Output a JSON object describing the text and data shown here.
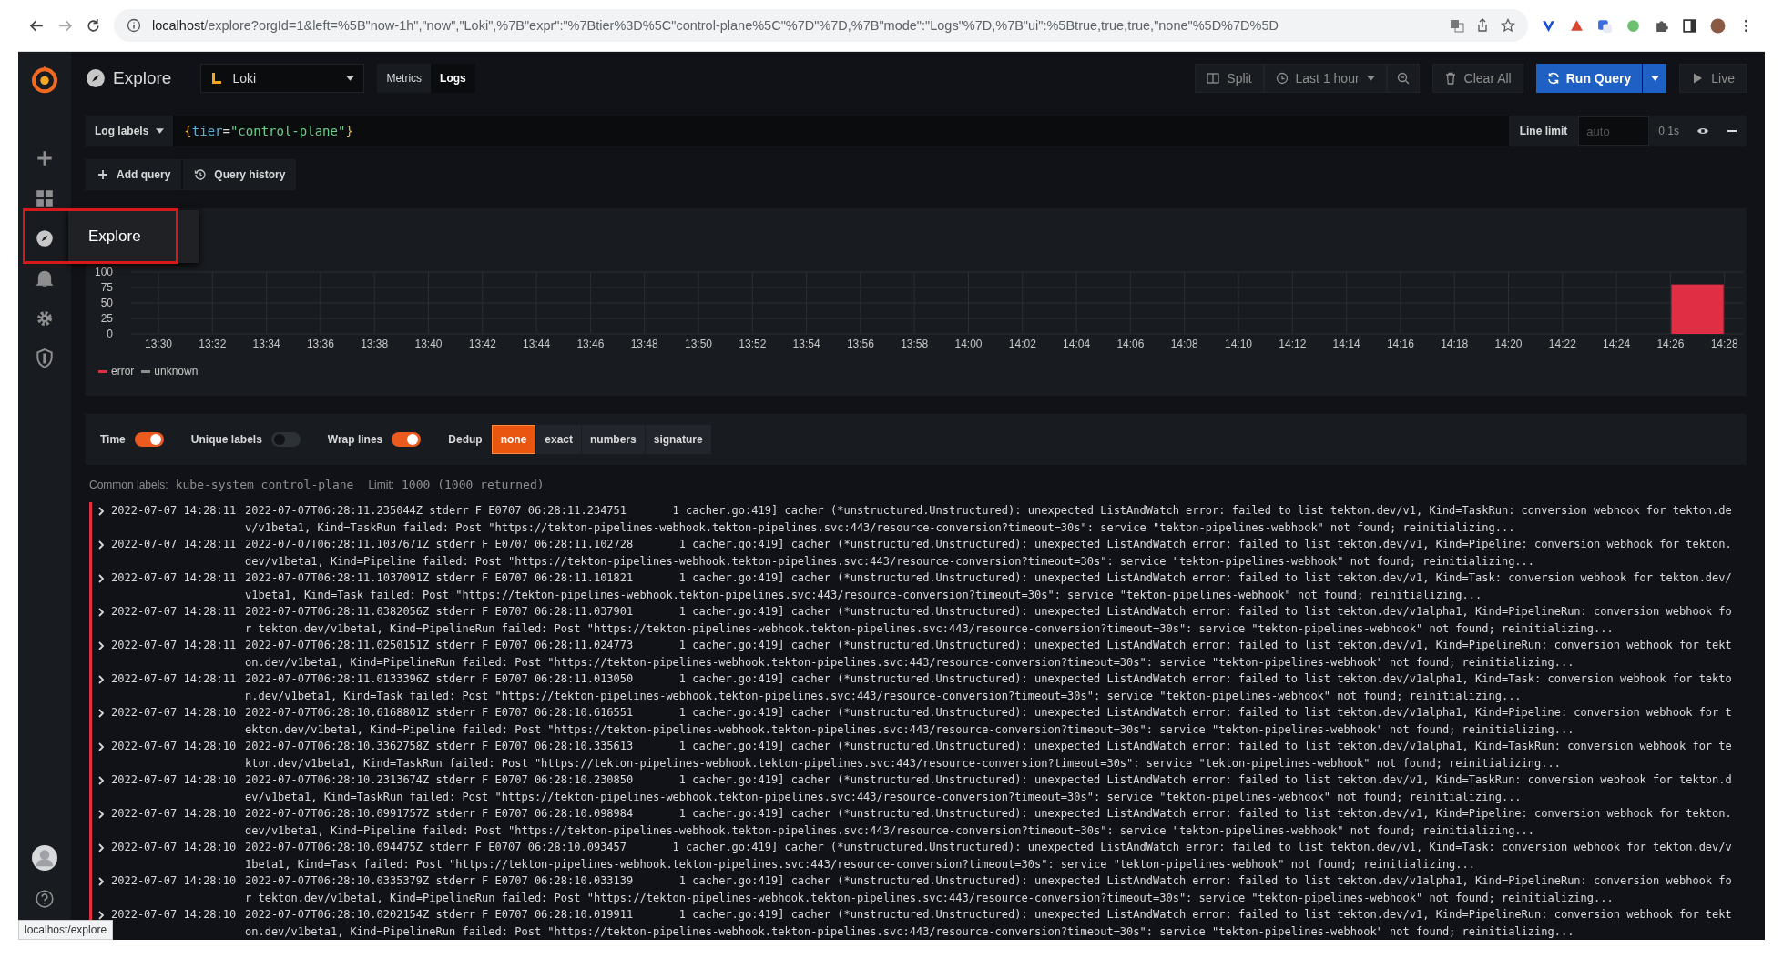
{
  "browser": {
    "host": "localhost",
    "path": "/explore?orgId=1&left=%5B\"now-1h\",\"now\",\"Loki\",%7B\"expr\":\"%7Btier%3D%5C\"control-plane%5C\"%7D\"%7D,%7B\"mode\":\"Logs\"%7D,%7B\"ui\":%5Btrue,true,true,\"none\"%5D%7D%5D"
  },
  "sidebar": {
    "flyout": "Explore"
  },
  "toolbar": {
    "title": "Explore",
    "datasource": "Loki",
    "modes": [
      {
        "label": "Metrics",
        "selected": false
      },
      {
        "label": "Logs",
        "selected": true
      }
    ],
    "split": "Split",
    "time_range": "Last 1 hour",
    "clear": "Clear All",
    "run": "Run Query",
    "live": "Live"
  },
  "query": {
    "labels_button": "Log labels",
    "expr_parts": [
      {
        "text": "{",
        "kind": "brace"
      },
      {
        "text": "tier",
        "kind": "key"
      },
      {
        "text": "=",
        "kind": "op"
      },
      {
        "text": "\"control-plane\"",
        "kind": "string"
      },
      {
        "text": "}",
        "kind": "brace"
      }
    ],
    "line_limit_label": "Line limit",
    "line_limit_placeholder": "auto",
    "duration": "0.1s"
  },
  "actions": [
    "Add query",
    "Query history"
  ],
  "graph": {
    "chart_data": {
      "type": "bar",
      "categories": [
        "13:30",
        "13:32",
        "13:34",
        "13:36",
        "13:38",
        "13:40",
        "13:42",
        "13:44",
        "13:46",
        "13:48",
        "13:50",
        "13:52",
        "13:54",
        "13:56",
        "13:58",
        "14:00",
        "14:02",
        "14:04",
        "14:06",
        "14:08",
        "14:10",
        "14:12",
        "14:14",
        "14:16",
        "14:18",
        "14:20",
        "14:22",
        "14:24",
        "14:26",
        "14:28"
      ],
      "series": [
        {
          "name": "error",
          "color": "#e02f44",
          "values": [
            null,
            null,
            null,
            null,
            null,
            null,
            null,
            null,
            null,
            null,
            null,
            null,
            null,
            null,
            null,
            null,
            null,
            null,
            null,
            null,
            null,
            null,
            null,
            null,
            null,
            null,
            null,
            null,
            80,
            null
          ]
        },
        {
          "name": "unknown",
          "color": "#8e8e8e",
          "values": [
            null,
            null,
            null,
            null,
            null,
            null,
            null,
            null,
            null,
            null,
            null,
            null,
            null,
            null,
            null,
            null,
            null,
            null,
            null,
            null,
            null,
            null,
            null,
            null,
            null,
            null,
            null,
            null,
            null,
            null
          ]
        }
      ],
      "ylim": [
        0,
        100
      ],
      "yticks": [
        0,
        25,
        50,
        75,
        100
      ],
      "grid": true
    }
  },
  "options": {
    "toggles": [
      {
        "label": "Time",
        "on": true
      },
      {
        "label": "Unique labels",
        "on": false
      },
      {
        "label": "Wrap lines",
        "on": true
      }
    ],
    "dedup_label": "Dedup",
    "dedup": [
      {
        "label": "none",
        "selected": true
      },
      {
        "label": "exact",
        "selected": false
      },
      {
        "label": "numbers",
        "selected": false
      },
      {
        "label": "signature",
        "selected": false
      }
    ]
  },
  "meta": {
    "common_label": "Common labels:",
    "common_value": "kube-system control-plane",
    "limit_label": "Limit:",
    "limit_value": "1000 (1000 returned)"
  },
  "logs": [
    {
      "time": "2022-07-07 14:28:11",
      "line": "2022-07-07T06:28:11.235044Z stderr F E0707 06:28:11.234751       1 cacher.go:419] cacher (*unstructured.Unstructured): unexpected ListAndWatch error: failed to list tekton.dev/v1, Kind=TaskRun: conversion webhook for tekton.dev/v1beta1, Kind=TaskRun failed: Post \"https://tekton-pipelines-webhook.tekton-pipelines.svc:443/resource-conversion?timeout=30s\": service \"tekton-pipelines-webhook\" not found; reinitializing..."
    },
    {
      "time": "2022-07-07 14:28:11",
      "line": "2022-07-07T06:28:11.1037671Z stderr F E0707 06:28:11.102728       1 cacher.go:419] cacher (*unstructured.Unstructured): unexpected ListAndWatch error: failed to list tekton.dev/v1, Kind=Pipeline: conversion webhook for tekton.dev/v1beta1, Kind=Pipeline failed: Post \"https://tekton-pipelines-webhook.tekton-pipelines.svc:443/resource-conversion?timeout=30s\": service \"tekton-pipelines-webhook\" not found; reinitializing..."
    },
    {
      "time": "2022-07-07 14:28:11",
      "line": "2022-07-07T06:28:11.1037091Z stderr F E0707 06:28:11.101821       1 cacher.go:419] cacher (*unstructured.Unstructured): unexpected ListAndWatch error: failed to list tekton.dev/v1, Kind=Task: conversion webhook for tekton.dev/v1beta1, Kind=Task failed: Post \"https://tekton-pipelines-webhook.tekton-pipelines.svc:443/resource-conversion?timeout=30s\": service \"tekton-pipelines-webhook\" not found; reinitializing..."
    },
    {
      "time": "2022-07-07 14:28:11",
      "line": "2022-07-07T06:28:11.0382056Z stderr F E0707 06:28:11.037901       1 cacher.go:419] cacher (*unstructured.Unstructured): unexpected ListAndWatch error: failed to list tekton.dev/v1alpha1, Kind=PipelineRun: conversion webhook for tekton.dev/v1beta1, Kind=PipelineRun failed: Post \"https://tekton-pipelines-webhook.tekton-pipelines.svc:443/resource-conversion?timeout=30s\": service \"tekton-pipelines-webhook\" not found; reinitializing..."
    },
    {
      "time": "2022-07-07 14:28:11",
      "line": "2022-07-07T06:28:11.0250151Z stderr F E0707 06:28:11.024773       1 cacher.go:419] cacher (*unstructured.Unstructured): unexpected ListAndWatch error: failed to list tekton.dev/v1, Kind=PipelineRun: conversion webhook for tekton.dev/v1beta1, Kind=PipelineRun failed: Post \"https://tekton-pipelines-webhook.tekton-pipelines.svc:443/resource-conversion?timeout=30s\": service \"tekton-pipelines-webhook\" not found; reinitializing..."
    },
    {
      "time": "2022-07-07 14:28:11",
      "line": "2022-07-07T06:28:11.0133396Z stderr F E0707 06:28:11.013050       1 cacher.go:419] cacher (*unstructured.Unstructured): unexpected ListAndWatch error: failed to list tekton.dev/v1alpha1, Kind=Task: conversion webhook for tekton.dev/v1beta1, Kind=Task failed: Post \"https://tekton-pipelines-webhook.tekton-pipelines.svc:443/resource-conversion?timeout=30s\": service \"tekton-pipelines-webhook\" not found; reinitializing..."
    },
    {
      "time": "2022-07-07 14:28:10",
      "line": "2022-07-07T06:28:10.6168801Z stderr F E0707 06:28:10.616551       1 cacher.go:419] cacher (*unstructured.Unstructured): unexpected ListAndWatch error: failed to list tekton.dev/v1alpha1, Kind=Pipeline: conversion webhook for tekton.dev/v1beta1, Kind=Pipeline failed: Post \"https://tekton-pipelines-webhook.tekton-pipelines.svc:443/resource-conversion?timeout=30s\": service \"tekton-pipelines-webhook\" not found; reinitializing..."
    },
    {
      "time": "2022-07-07 14:28:10",
      "line": "2022-07-07T06:28:10.3362758Z stderr F E0707 06:28:10.335613       1 cacher.go:419] cacher (*unstructured.Unstructured): unexpected ListAndWatch error: failed to list tekton.dev/v1alpha1, Kind=TaskRun: conversion webhook for tekton.dev/v1beta1, Kind=TaskRun failed: Post \"https://tekton-pipelines-webhook.tekton-pipelines.svc:443/resource-conversion?timeout=30s\": service \"tekton-pipelines-webhook\" not found; reinitializing..."
    },
    {
      "time": "2022-07-07 14:28:10",
      "line": "2022-07-07T06:28:10.2313674Z stderr F E0707 06:28:10.230850       1 cacher.go:419] cacher (*unstructured.Unstructured): unexpected ListAndWatch error: failed to list tekton.dev/v1, Kind=TaskRun: conversion webhook for tekton.dev/v1beta1, Kind=TaskRun failed: Post \"https://tekton-pipelines-webhook.tekton-pipelines.svc:443/resource-conversion?timeout=30s\": service \"tekton-pipelines-webhook\" not found; reinitializing..."
    },
    {
      "time": "2022-07-07 14:28:10",
      "line": "2022-07-07T06:28:10.0991757Z stderr F E0707 06:28:10.098984       1 cacher.go:419] cacher (*unstructured.Unstructured): unexpected ListAndWatch error: failed to list tekton.dev/v1, Kind=Pipeline: conversion webhook for tekton.dev/v1beta1, Kind=Pipeline failed: Post \"https://tekton-pipelines-webhook.tekton-pipelines.svc:443/resource-conversion?timeout=30s\": service \"tekton-pipelines-webhook\" not found; reinitializing..."
    },
    {
      "time": "2022-07-07 14:28:10",
      "line": "2022-07-07T06:28:10.094475Z stderr F E0707 06:28:10.093457       1 cacher.go:419] cacher (*unstructured.Unstructured): unexpected ListAndWatch error: failed to list tekton.dev/v1, Kind=Task: conversion webhook for tekton.dev/v1beta1, Kind=Task failed: Post \"https://tekton-pipelines-webhook.tekton-pipelines.svc:443/resource-conversion?timeout=30s\": service \"tekton-pipelines-webhook\" not found; reinitializing..."
    },
    {
      "time": "2022-07-07 14:28:10",
      "line": "2022-07-07T06:28:10.0335379Z stderr F E0707 06:28:10.033139       1 cacher.go:419] cacher (*unstructured.Unstructured): unexpected ListAndWatch error: failed to list tekton.dev/v1alpha1, Kind=PipelineRun: conversion webhook for tekton.dev/v1beta1, Kind=PipelineRun failed: Post \"https://tekton-pipelines-webhook.tekton-pipelines.svc:443/resource-conversion?timeout=30s\": service \"tekton-pipelines-webhook\" not found; reinitializing..."
    },
    {
      "time": "2022-07-07 14:28:10",
      "line": "2022-07-07T06:28:10.0202154Z stderr F E0707 06:28:10.019911       1 cacher.go:419] cacher (*unstructured.Unstructured): unexpected ListAndWatch error: failed to list tekton.dev/v1, Kind=PipelineRun: conversion webhook for tekton.dev/v1beta1, Kind=PipelineRun failed: Post \"https://tekton-pipelines-webhook.tekton-pipelines.svc:443/resource-conversion?timeout=30s\": service \"tekton-pipelines-webhook\" not found; reinitializing..."
    }
  ],
  "status_url": "localhost/explore"
}
